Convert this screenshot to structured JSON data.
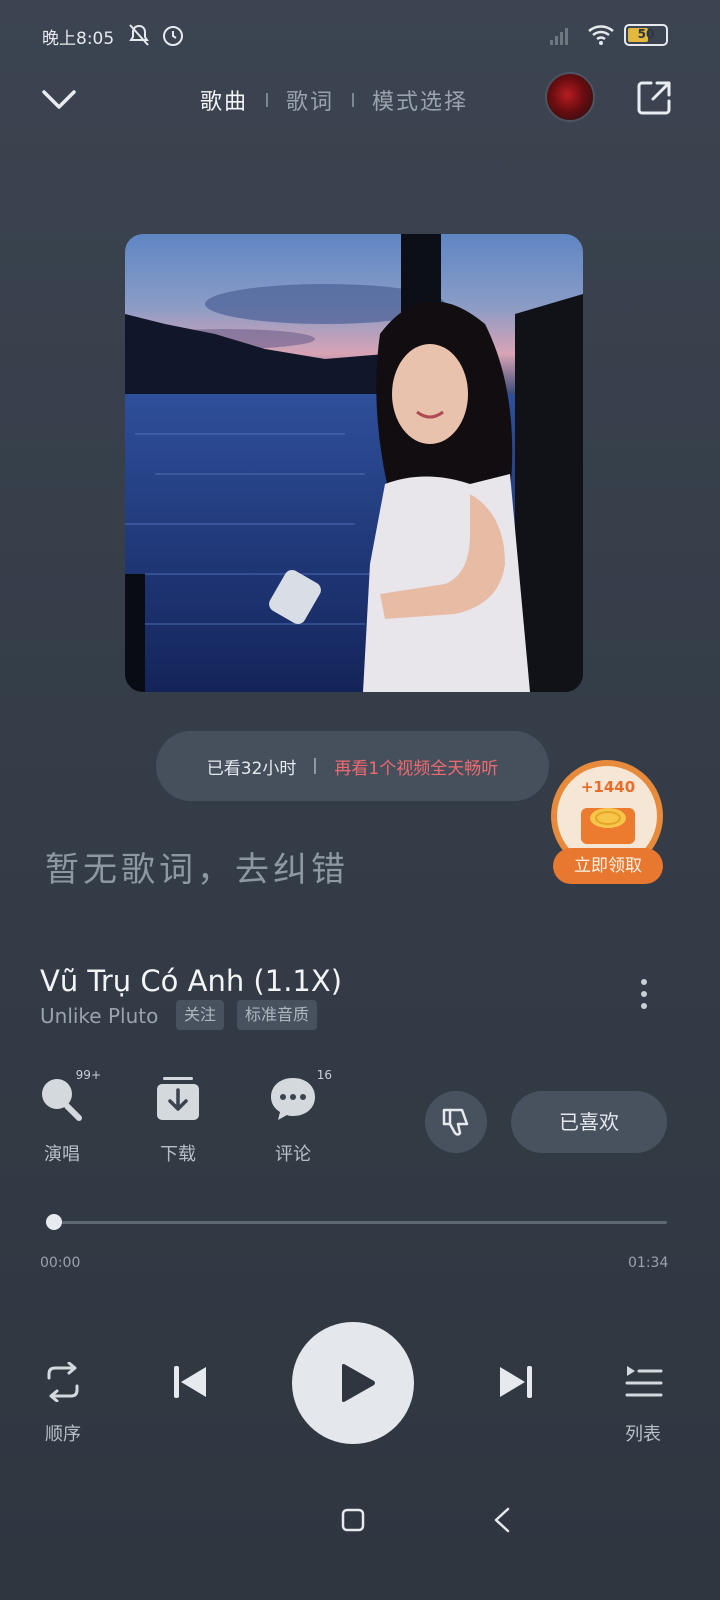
{
  "status_bar": {
    "time": "晚上8:05",
    "battery": "50"
  },
  "header": {
    "tabs": [
      {
        "label": "歌曲",
        "active": true
      },
      {
        "label": "歌词",
        "active": false
      },
      {
        "label": "模式选择",
        "active": false
      }
    ]
  },
  "watch_banner": {
    "watched": "已看32小时",
    "promo": "再看1个视频全天畅听"
  },
  "reward": {
    "amount": "+1440",
    "button": "立即领取"
  },
  "lyrics": {
    "placeholder": "暂无歌词，去纠错"
  },
  "song": {
    "title": "Vũ Trụ Có Anh (1.1X)",
    "artist": "Unlike Pluto",
    "follow_chip": "关注",
    "quality_chip": "标准音质"
  },
  "actions": [
    {
      "label": "演唱",
      "badge": "99+",
      "icon": "mic-icon"
    },
    {
      "label": "下载",
      "badge": "",
      "icon": "download-icon"
    },
    {
      "label": "评论",
      "badge": "16",
      "icon": "comment-icon"
    }
  ],
  "like_button": "已喜欢",
  "progress": {
    "current": "00:00",
    "duration": "01:34",
    "fraction": 0.0
  },
  "controls": {
    "mode_label": "顺序",
    "list_label": "列表"
  },
  "colors": {
    "accent_promo": "#f06a70",
    "reward_orange": "#e8772f",
    "background": "#343d48"
  }
}
